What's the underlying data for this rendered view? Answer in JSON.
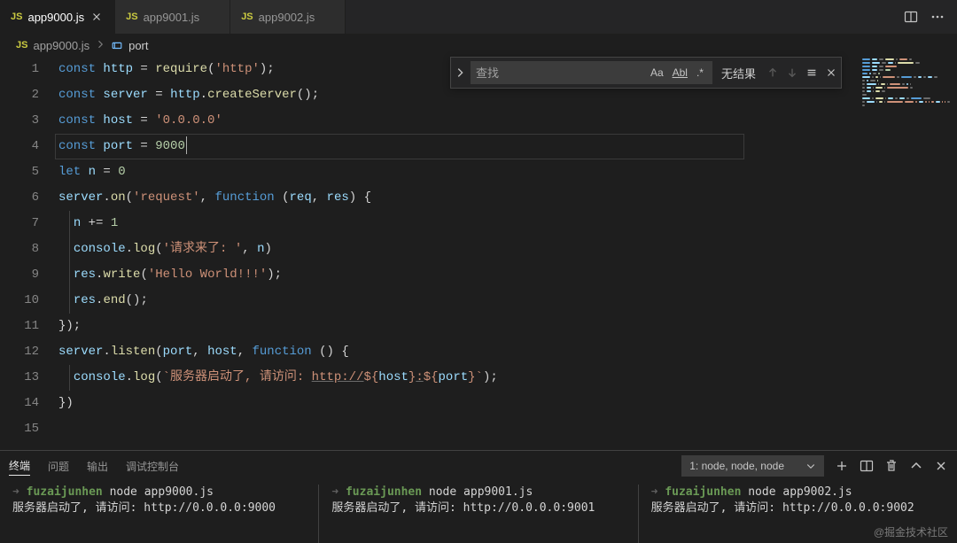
{
  "tabs": [
    {
      "icon": "JS",
      "label": "app9000.js",
      "active": true
    },
    {
      "icon": "JS",
      "label": "app9001.js",
      "active": false
    },
    {
      "icon": "JS",
      "label": "app9002.js",
      "active": false
    }
  ],
  "tab_actions": {
    "split": "split-editor",
    "more": "more-actions"
  },
  "breadcrumb": {
    "file_icon": "JS",
    "file": "app9000.js",
    "symbol_icon": "variable",
    "symbol": "port"
  },
  "find": {
    "placeholder": "查找",
    "value": "",
    "match_case": "Aa",
    "whole_word": "Abl",
    "regex": ".*",
    "results": "无结果"
  },
  "code": {
    "lines": [
      {
        "n": 1,
        "tokens": [
          [
            "kw",
            "const "
          ],
          [
            "var",
            "http"
          ],
          [
            "op",
            " = "
          ],
          [
            "fn",
            "require"
          ],
          [
            "op",
            "("
          ],
          [
            "str",
            "'http'"
          ],
          [
            "op",
            ");"
          ]
        ]
      },
      {
        "n": 2,
        "tokens": [
          [
            "kw",
            "const "
          ],
          [
            "var",
            "server"
          ],
          [
            "op",
            " = "
          ],
          [
            "var",
            "http"
          ],
          [
            "op",
            "."
          ],
          [
            "fn",
            "createServer"
          ],
          [
            "op",
            "();"
          ]
        ]
      },
      {
        "n": 3,
        "tokens": [
          [
            "kw",
            "const "
          ],
          [
            "var",
            "host"
          ],
          [
            "op",
            " = "
          ],
          [
            "str",
            "'0.0.0.0'"
          ]
        ]
      },
      {
        "n": 4,
        "current": true,
        "tokens": [
          [
            "kw",
            "const "
          ],
          [
            "var",
            "port"
          ],
          [
            "op",
            " = "
          ],
          [
            "num",
            "9000"
          ]
        ],
        "cursor_after": true
      },
      {
        "n": 5,
        "tokens": [
          [
            "kw",
            "let "
          ],
          [
            "var",
            "n"
          ],
          [
            "op",
            " = "
          ],
          [
            "num",
            "0"
          ]
        ]
      },
      {
        "n": 6,
        "tokens": [
          [
            "var",
            "server"
          ],
          [
            "op",
            "."
          ],
          [
            "fn",
            "on"
          ],
          [
            "op",
            "("
          ],
          [
            "str",
            "'request'"
          ],
          [
            "op",
            ", "
          ],
          [
            "kw",
            "function"
          ],
          [
            "op",
            " ("
          ],
          [
            "var",
            "req"
          ],
          [
            "op",
            ", "
          ],
          [
            "var",
            "res"
          ],
          [
            "op",
            ") {"
          ]
        ]
      },
      {
        "n": 7,
        "indent": 1,
        "tokens": [
          [
            "op",
            "  "
          ],
          [
            "var",
            "n"
          ],
          [
            "op",
            " += "
          ],
          [
            "num",
            "1"
          ]
        ]
      },
      {
        "n": 8,
        "indent": 1,
        "tokens": [
          [
            "op",
            "  "
          ],
          [
            "var",
            "console"
          ],
          [
            "op",
            "."
          ],
          [
            "fn",
            "log"
          ],
          [
            "op",
            "("
          ],
          [
            "str",
            "'请求来了: '"
          ],
          [
            "op",
            ", "
          ],
          [
            "var",
            "n"
          ],
          [
            "op",
            ")"
          ]
        ]
      },
      {
        "n": 9,
        "indent": 1,
        "tokens": [
          [
            "op",
            "  "
          ],
          [
            "var",
            "res"
          ],
          [
            "op",
            "."
          ],
          [
            "fn",
            "write"
          ],
          [
            "op",
            "("
          ],
          [
            "str",
            "'Hello World!!!'"
          ],
          [
            "op",
            ");"
          ]
        ]
      },
      {
        "n": 10,
        "indent": 1,
        "tokens": [
          [
            "op",
            "  "
          ],
          [
            "var",
            "res"
          ],
          [
            "op",
            "."
          ],
          [
            "fn",
            "end"
          ],
          [
            "op",
            "();"
          ]
        ]
      },
      {
        "n": 11,
        "tokens": [
          [
            "op",
            "});"
          ]
        ]
      },
      {
        "n": 12,
        "tokens": [
          [
            "var",
            "server"
          ],
          [
            "op",
            "."
          ],
          [
            "fn",
            "listen"
          ],
          [
            "op",
            "("
          ],
          [
            "var",
            "port"
          ],
          [
            "op",
            ", "
          ],
          [
            "var",
            "host"
          ],
          [
            "op",
            ", "
          ],
          [
            "kw",
            "function"
          ],
          [
            "op",
            " () {"
          ]
        ]
      },
      {
        "n": 13,
        "indent": 1,
        "tokens": [
          [
            "op",
            "  "
          ],
          [
            "var",
            "console"
          ],
          [
            "op",
            "."
          ],
          [
            "fn",
            "log"
          ],
          [
            "op",
            "("
          ],
          [
            "tpl",
            "`服务器启动了, 请访问: "
          ],
          [
            "link",
            "http://"
          ],
          [
            "tpl",
            "${"
          ],
          [
            "tplv",
            "host"
          ],
          [
            "tpl",
            "}"
          ],
          [
            "link",
            ":"
          ],
          [
            "tpl",
            "${"
          ],
          [
            "tplv",
            "port"
          ],
          [
            "tpl",
            "}"
          ],
          [
            "tpl",
            "`"
          ],
          [
            "op",
            ");"
          ]
        ]
      },
      {
        "n": 14,
        "tokens": [
          [
            "op",
            "})"
          ]
        ]
      },
      {
        "n": 15,
        "tokens": []
      }
    ]
  },
  "panel": {
    "tabs": [
      {
        "label": "终端",
        "active": true
      },
      {
        "label": "问题",
        "active": false
      },
      {
        "label": "输出",
        "active": false
      },
      {
        "label": "调试控制台",
        "active": false
      }
    ],
    "terminal_selector": "1: node, node, node",
    "terminals": [
      {
        "user": "fuzaijunhen",
        "cmd": "node app9000.js",
        "out": "服务器启动了, 请访问: http://0.0.0.0:9000"
      },
      {
        "user": "fuzaijunhen",
        "cmd": "node app9001.js",
        "out": "服务器启动了, 请访问: http://0.0.0.0:9001"
      },
      {
        "user": "fuzaijunhen",
        "cmd": "node app9002.js",
        "out": "服务器启动了, 请访问: http://0.0.0.0:9002"
      }
    ]
  },
  "watermark": "@掘金技术社区"
}
